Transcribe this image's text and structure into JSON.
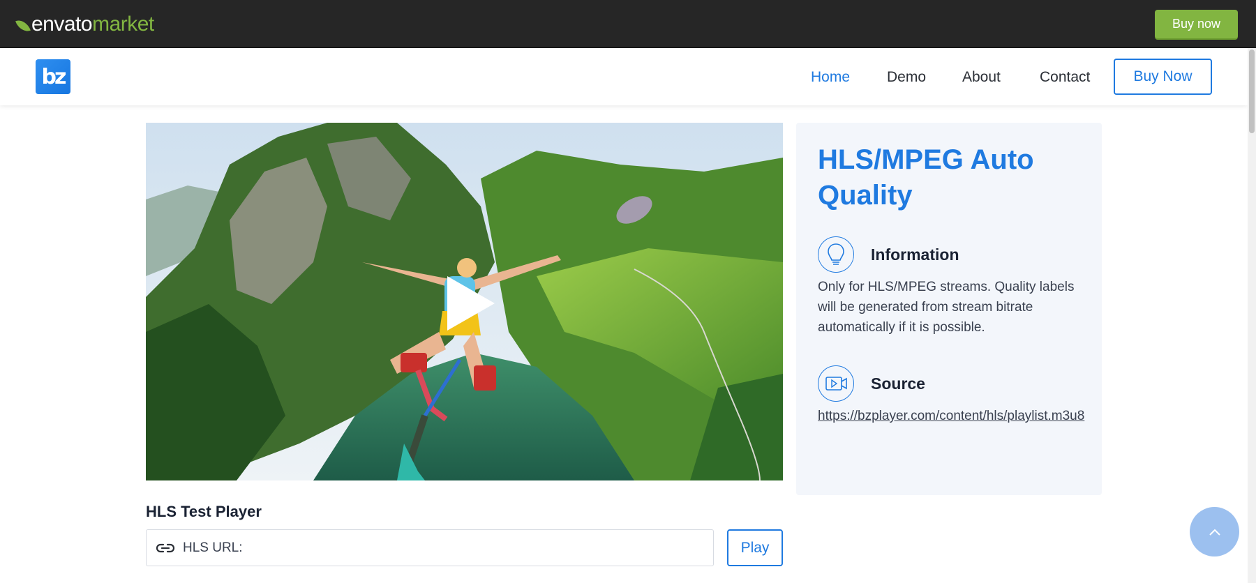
{
  "envato_bar": {
    "logo_envato": "envato",
    "logo_market": "market",
    "buy_label": "Buy now",
    "accent_color": "#82b541"
  },
  "header": {
    "logo_text": "bz",
    "nav": [
      {
        "label": "Home",
        "active": true
      },
      {
        "label": "Demo",
        "active": false
      },
      {
        "label": "About",
        "active": false
      },
      {
        "label": "Contact",
        "active": false
      }
    ],
    "buy_label": "Buy Now",
    "accent_color": "#1f7ae0"
  },
  "video": {
    "play_icon": "play-icon"
  },
  "info": {
    "title": "HLS/MPEG Auto Quality",
    "features": [
      {
        "icon": "lightbulb-icon",
        "title": "Information",
        "text": "Only for HLS/MPEG streams. Quality labels will be generated from stream bitrate automatically if it is possible."
      },
      {
        "icon": "video-camera-icon",
        "title": "Source",
        "link": "https://bzplayer.com/content/hls/playlist.m3u8"
      }
    ]
  },
  "test_player": {
    "title": "HLS Test Player",
    "url_placeholder": "HLS URL:",
    "url_icon": "link-icon",
    "play_label": "Play"
  },
  "back_to_top": {
    "icon": "chevron-up-icon"
  }
}
